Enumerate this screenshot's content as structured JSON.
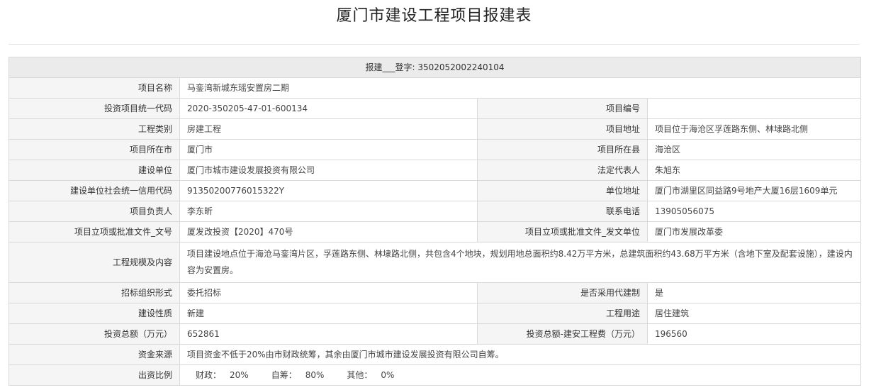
{
  "page_title": "厦门市建设工程项目报建表",
  "header": {
    "text": "报建___登字: 3502052002240104"
  },
  "rows": {
    "project_name": {
      "label": "项目名称",
      "value": "马銮湾新城东瑶安置房二期"
    },
    "invest_code": {
      "label": "投资项目统一代码",
      "value": "2020-350205-47-01-600134"
    },
    "project_no": {
      "label": "项目编号",
      "value": ""
    },
    "eng_type": {
      "label": "工程类别",
      "value": "房建工程"
    },
    "project_addr": {
      "label": "项目地址",
      "value": "项目位于海沧区孚莲路东侧、林埭路北侧"
    },
    "city": {
      "label": "项目所在市",
      "value": "厦门市"
    },
    "county": {
      "label": "项目所在县",
      "value": "海沧区"
    },
    "builder": {
      "label": "建设单位",
      "value": "厦门市城市建设发展投资有限公司"
    },
    "legal_rep": {
      "label": "法定代表人",
      "value": "朱旭东"
    },
    "credit_code": {
      "label": "建设单位社会统一信用代码",
      "value": "91350200776015322Y"
    },
    "unit_addr": {
      "label": "单位地址",
      "value": "厦门市湖里区同益路9号地产大厦16层1609单元"
    },
    "leader": {
      "label": "项目负责人",
      "value": "李东昕"
    },
    "phone": {
      "label": "联系电话",
      "value": "13905056075"
    },
    "doc_no": {
      "label": "项目立项或批准文件_文号",
      "value": "厦发改投资【2020】470号"
    },
    "doc_unit": {
      "label": "项目立项或批准文件_发文单位",
      "value": "厦门市发展改革委"
    },
    "scale": {
      "label": "工程规模及内容",
      "value": "项目建设地点位于海沧马銮湾片区，孚莲路东侧、林埭路北侧，共包含4个地块，规划用地总面积约8.42万平方米，总建筑面积约43.68万平方米（含地下室及配套设施），建设内容为安置房。"
    },
    "bid_form": {
      "label": "招标组织形式",
      "value": "委托招标"
    },
    "agent_build": {
      "label": "是否采用代建制",
      "value": "是"
    },
    "nature": {
      "label": "建设性质",
      "value": "新建"
    },
    "usage": {
      "label": "工程用途",
      "value": "居住建筑"
    },
    "total_invest": {
      "label": "投资总额（万元）",
      "value": "652861"
    },
    "install_fee": {
      "label": "投资总额-建安工程费（万元）",
      "value": "196560"
    },
    "fund_source": {
      "label": "资金来源",
      "value": "项目资金不低于20%由市财政统筹，其余由厦门市城市建设发展投资有限公司自筹。"
    },
    "fund_ratio": {
      "label": "出资比例",
      "fiscal_label": "财政：",
      "fiscal_value": "20%",
      "self_label": "自筹：",
      "self_value": "80%",
      "other_label": "其他：",
      "other_value": "0%"
    }
  }
}
